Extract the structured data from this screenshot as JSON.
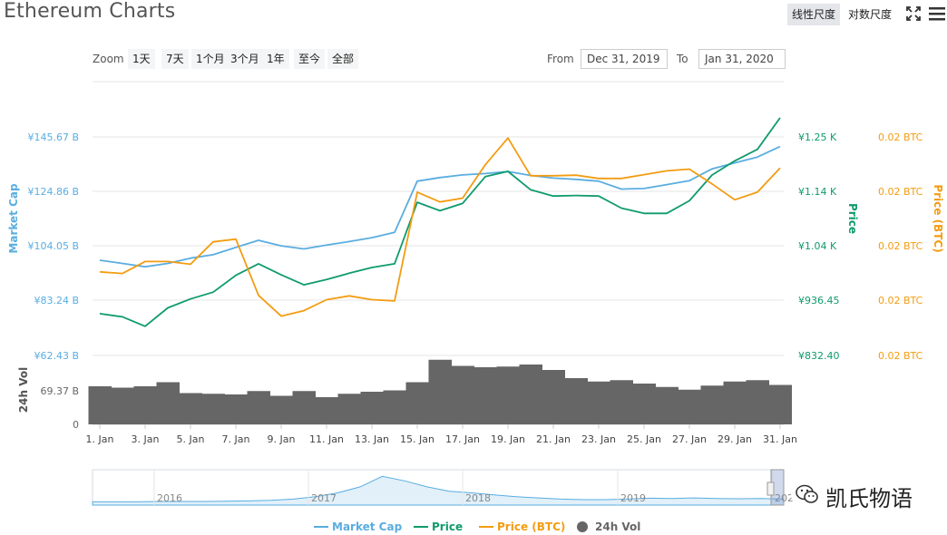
{
  "header": {
    "title": "Ethereum Charts",
    "scale_linear": "线性尺度",
    "scale_log": "对数尺度"
  },
  "toolbar": {
    "zoom_label": "Zoom",
    "zoom_options": [
      "1天",
      "7天",
      "1个月",
      "3个月",
      "1年",
      "至今",
      "全部"
    ],
    "from_label": "From",
    "from_value": "Dec 31, 2019",
    "to_label": "To",
    "to_value": "Jan 31, 2020"
  },
  "icons": [
    "expand-icon",
    "menu-icon"
  ],
  "colors": {
    "market_cap": "#5aade0",
    "price": "#0f9b6d",
    "price_btc": "#f39c12",
    "volume": "#666666"
  },
  "watermark": "凯氏物语",
  "chart_data": {
    "type": "line",
    "title": "Ethereum Charts",
    "x": [
      "1. Jan",
      "2. Jan",
      "3. Jan",
      "4. Jan",
      "5. Jan",
      "6. Jan",
      "7. Jan",
      "8. Jan",
      "9. Jan",
      "10. Jan",
      "11. Jan",
      "12. Jan",
      "13. Jan",
      "14. Jan",
      "15. Jan",
      "16. Jan",
      "17. Jan",
      "18. Jan",
      "19. Jan",
      "20. Jan",
      "21. Jan",
      "22. Jan",
      "23. Jan",
      "24. Jan",
      "25. Jan",
      "26. Jan",
      "27. Jan",
      "28. Jan",
      "29. Jan",
      "30. Jan",
      "31. Jan"
    ],
    "xticks": [
      "1. Jan",
      "3. Jan",
      "5. Jan",
      "7. Jan",
      "9. Jan",
      "11. Jan",
      "13. Jan",
      "15. Jan",
      "17. Jan",
      "19. Jan",
      "21. Jan",
      "23. Jan",
      "25. Jan",
      "27. Jan",
      "29. Jan",
      "31. Jan"
    ],
    "axes": {
      "market_cap": {
        "label": "Market Cap",
        "ticks": [
          "¥145.67 B",
          "¥124.86 B",
          "¥104.05 B",
          "¥83.24 B",
          "¥62.43 B"
        ],
        "range": [
          62.43,
          145.67
        ]
      },
      "price": {
        "label": "Price",
        "ticks": [
          "¥1.25 K",
          "¥1.14 K",
          "¥1.04 K",
          "¥936.45",
          "¥832.40"
        ],
        "range": [
          832.4,
          1248.6
        ]
      },
      "price_btc": {
        "label": "Price (BTC)",
        "ticks": [
          "0.02 BTC",
          "0.02 BTC",
          "0.02 BTC",
          "0.02 BTC",
          "0.02 BTC"
        ],
        "range": [
          0,
          4
        ]
      },
      "volume": {
        "label": "24h Vol",
        "ticks": [
          "69.37 B",
          "0"
        ],
        "range": [
          0,
          100
        ]
      }
    },
    "series": [
      {
        "name": "Market Cap",
        "axis": "market_cap",
        "values": [
          98.7,
          97.5,
          96.2,
          97.5,
          99.5,
          100.8,
          103.6,
          106.3,
          104.2,
          103.0,
          104.5,
          105.8,
          107.3,
          109.3,
          128.8,
          130.2,
          131.2,
          131.7,
          132.5,
          131.0,
          130.0,
          129.5,
          128.8,
          125.8,
          126.0,
          127.5,
          129.0,
          133.5,
          135.8,
          138.0,
          142.0
        ]
      },
      {
        "name": "Price",
        "axis": "price",
        "values": [
          912,
          906,
          888,
          923,
          940,
          953,
          985,
          1007,
          986,
          967,
          977,
          989,
          1000,
          1007,
          1124,
          1108,
          1122,
          1173,
          1183,
          1148,
          1136,
          1137,
          1136,
          1113,
          1103,
          1103,
          1127,
          1176,
          1203,
          1225,
          1285
        ]
      },
      {
        "name": "Price (BTC)",
        "axis": "price_btc",
        "values": [
          1.53,
          1.5,
          1.72,
          1.72,
          1.67,
          2.08,
          2.13,
          1.1,
          0.72,
          0.82,
          1.02,
          1.09,
          1.02,
          1.0,
          2.99,
          2.81,
          2.88,
          3.49,
          3.98,
          3.29,
          3.29,
          3.3,
          3.24,
          3.24,
          3.31,
          3.38,
          3.41,
          3.14,
          2.85,
          2.99,
          3.43
        ]
      },
      {
        "name": "24h Vol",
        "axis": "volume",
        "type": "bar",
        "values": [
          56,
          54,
          56,
          62,
          46,
          45,
          44,
          49,
          42,
          49,
          40,
          45,
          48,
          50,
          62,
          95,
          86,
          84,
          85,
          88,
          80,
          68,
          63,
          65,
          60,
          55,
          51,
          57,
          63,
          65,
          58
        ]
      }
    ],
    "navigator": {
      "labels": [
        "2016",
        "2017",
        "2018",
        "2019",
        "2020"
      ]
    },
    "legend": {
      "position": "bottom",
      "items": [
        "Market Cap",
        "Price",
        "Price (BTC)",
        "24h Vol"
      ]
    },
    "grid": true
  }
}
